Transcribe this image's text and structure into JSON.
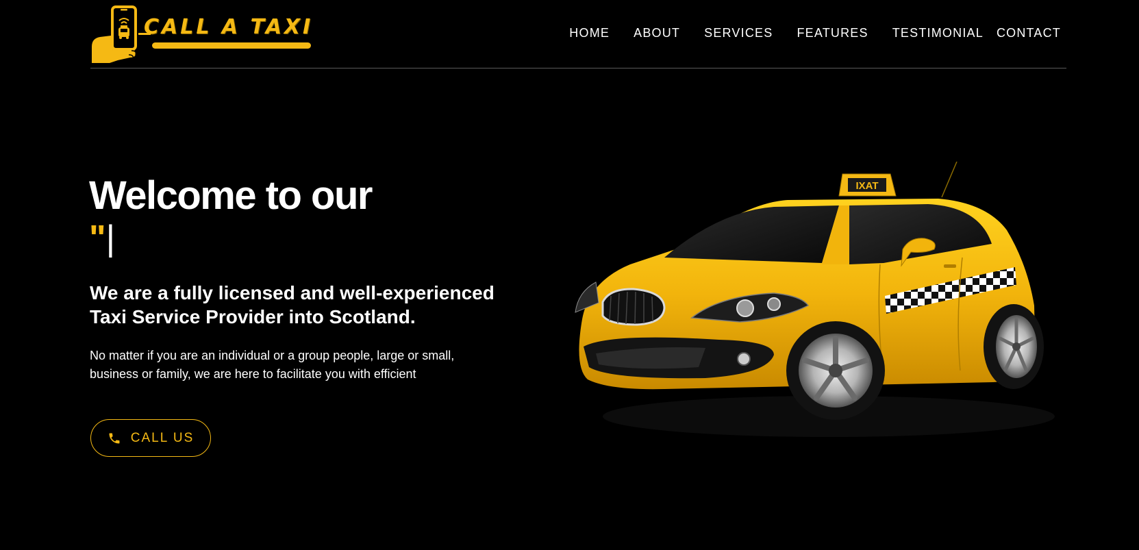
{
  "brand": {
    "logo_text": "CALL A TAXI",
    "accent_color": "#f5b914"
  },
  "nav": {
    "items": [
      {
        "label": "HOME"
      },
      {
        "label": "ABOUT"
      },
      {
        "label": "SERVICES"
      },
      {
        "label": "FEATURES"
      },
      {
        "label": "TESTIMONIAL"
      },
      {
        "label": "CONTACT"
      }
    ]
  },
  "hero": {
    "title": "Welcome to our",
    "typed_text": "\"",
    "typed_cursor": "|",
    "subtitle": "We are a fully licensed and well-experienced Taxi Service Provider into Scotland.",
    "description": "No matter if you are an individual or a group people, large or small, business or family, we are here to facilitate you with efficient",
    "cta": {
      "label": "CALL US",
      "icon": "phone-icon"
    }
  },
  "taxi_image": {
    "roof_sign_text": "IXAT"
  }
}
